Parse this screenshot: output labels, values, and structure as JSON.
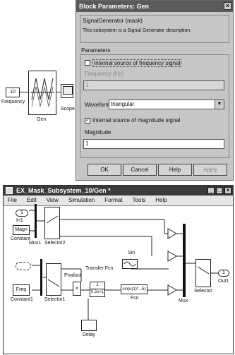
{
  "diagram_top": {
    "const_value": "10",
    "const_label": "Frequency",
    "gen_label": "Gen",
    "scope_label": "Scope"
  },
  "dialog": {
    "title": "Block Parameters: Gen",
    "close_glyph": "×",
    "mask_title": "SignalGenerator (mask)",
    "mask_description": "This subsystem is a Signal Generator description.",
    "params_label": "Parameters",
    "ext_freq_label": "Internal source of frequency signal",
    "ext_freq_checked": false,
    "freq_label": "Frequency (Hz)",
    "freq_value": "1",
    "waveform_label": "Waveform",
    "waveform_value": "triangular",
    "ext_mag_label": "Internal source of magnitude signal",
    "ext_mag_checked": true,
    "magnitude_label": "Magnitude",
    "magnitude_value": "1",
    "ok": "OK",
    "cancel": "Cancel",
    "help": "Help",
    "apply": "Apply"
  },
  "window": {
    "title": "EX_Mask_Subsystem_10/Gen *",
    "menu": [
      "File",
      "Edit",
      "View",
      "Simulation",
      "Format",
      "Tools",
      "Help"
    ],
    "blocks": {
      "in1": "1",
      "in1_label": "In1",
      "magn": "Magn",
      "constant": "Constant",
      "constant1": "Constant1",
      "freq": "Freq",
      "mux1": "Mux1",
      "selector2": "Selector2",
      "selector1": "Selector1",
      "product": "Product",
      "transfer_fcn": "Transfer Fcn",
      "tf_num": "1",
      "tf_den": "0.5s+1",
      "sin": "Sin",
      "fcn_expr": "sin(u(1)*...5)",
      "fcn": "Fcn",
      "delay": "Delay",
      "selector": "Selector",
      "mux": "Mux",
      "out1": "1",
      "out1_label": "Out1"
    }
  }
}
